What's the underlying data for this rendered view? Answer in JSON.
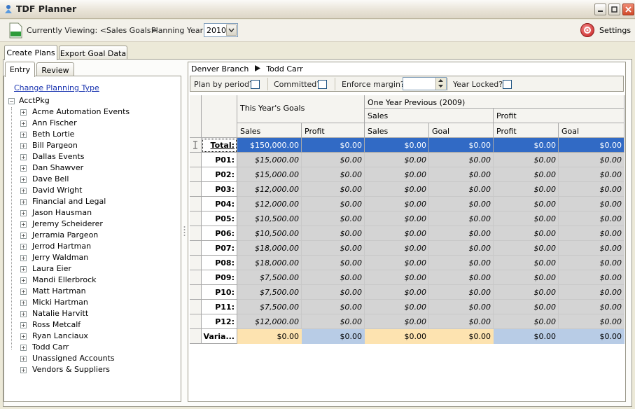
{
  "window": {
    "title": "TDF Planner"
  },
  "toolbar": {
    "viewing_label": "Currently Viewing: <Sales Goals>",
    "planning_year_label": "Planning Year:",
    "planning_year_value": "2010",
    "settings_label": "Settings"
  },
  "top_tabs": [
    "Create Plans",
    "Export Goal Data"
  ],
  "left_tabs": [
    "Entry",
    "Review"
  ],
  "left_panel": {
    "change_link": "Change Planning Type",
    "tree_root": "AcctPkg",
    "tree_items": [
      "Acme Automation Events",
      "Ann Fischer",
      "Beth Lortie",
      "Bill Pargeon",
      "Dallas Events",
      "Dan Shawver",
      "Dave Bell",
      "David Wright",
      "Financial and Legal",
      "Jason Hausman",
      "Jeremy Scheiderer",
      "Jerramia Pargeon",
      "Jerrod Hartman",
      "Jerry Waldman",
      "Laura Eier",
      "Mandi Ellerbrock",
      "Matt Hartman",
      "Micki Hartman",
      "Natalie Harvitt",
      "Ross Metcalf",
      "Ryan Lanciaux",
      "Todd Carr",
      "Unassigned Accounts",
      "Vendors & Suppliers"
    ]
  },
  "breadcrumb": {
    "branch": "Denver Branch",
    "person": "Todd Carr"
  },
  "options": {
    "plan_by_period": "Plan by period?",
    "committed": "Committed?",
    "enforce_margin": "Enforce margin?",
    "year_locked": "Year Locked?"
  },
  "grid": {
    "group_this_year": "This Year's Goals",
    "group_prev": "One Year Previous (2009)",
    "sub_sales": "Sales",
    "sub_profit": "Profit",
    "columns": [
      "Sales",
      "Profit",
      "Sales",
      "Goal",
      "Profit",
      "Goal"
    ],
    "rows": [
      {
        "label": "Total:",
        "values": [
          "$150,000.00",
          "$0.00",
          "$0.00",
          "$0.00",
          "$0.00",
          "$0.00"
        ]
      },
      {
        "label": "P01:",
        "values": [
          "$15,000.00",
          "$0.00",
          "$0.00",
          "$0.00",
          "$0.00",
          "$0.00"
        ]
      },
      {
        "label": "P02:",
        "values": [
          "$15,000.00",
          "$0.00",
          "$0.00",
          "$0.00",
          "$0.00",
          "$0.00"
        ]
      },
      {
        "label": "P03:",
        "values": [
          "$12,000.00",
          "$0.00",
          "$0.00",
          "$0.00",
          "$0.00",
          "$0.00"
        ]
      },
      {
        "label": "P04:",
        "values": [
          "$12,000.00",
          "$0.00",
          "$0.00",
          "$0.00",
          "$0.00",
          "$0.00"
        ]
      },
      {
        "label": "P05:",
        "values": [
          "$10,500.00",
          "$0.00",
          "$0.00",
          "$0.00",
          "$0.00",
          "$0.00"
        ]
      },
      {
        "label": "P06:",
        "values": [
          "$10,500.00",
          "$0.00",
          "$0.00",
          "$0.00",
          "$0.00",
          "$0.00"
        ]
      },
      {
        "label": "P07:",
        "values": [
          "$18,000.00",
          "$0.00",
          "$0.00",
          "$0.00",
          "$0.00",
          "$0.00"
        ]
      },
      {
        "label": "P08:",
        "values": [
          "$18,000.00",
          "$0.00",
          "$0.00",
          "$0.00",
          "$0.00",
          "$0.00"
        ]
      },
      {
        "label": "P09:",
        "values": [
          "$7,500.00",
          "$0.00",
          "$0.00",
          "$0.00",
          "$0.00",
          "$0.00"
        ]
      },
      {
        "label": "P10:",
        "values": [
          "$7,500.00",
          "$0.00",
          "$0.00",
          "$0.00",
          "$0.00",
          "$0.00"
        ]
      },
      {
        "label": "P11:",
        "values": [
          "$7,500.00",
          "$0.00",
          "$0.00",
          "$0.00",
          "$0.00",
          "$0.00"
        ]
      },
      {
        "label": "P12:",
        "values": [
          "$12,000.00",
          "$0.00",
          "$0.00",
          "$0.00",
          "$0.00",
          "$0.00"
        ]
      },
      {
        "label": "Varia...",
        "values": [
          "$0.00",
          "$0.00",
          "$0.00",
          "$0.00",
          "$0.00",
          "$0.00"
        ]
      }
    ]
  },
  "colors": {
    "selection": "#316ac5",
    "readonly_cell": "#d4d4d4",
    "variance_orange": "#fde3b0",
    "variance_blue": "#b8cce6"
  }
}
